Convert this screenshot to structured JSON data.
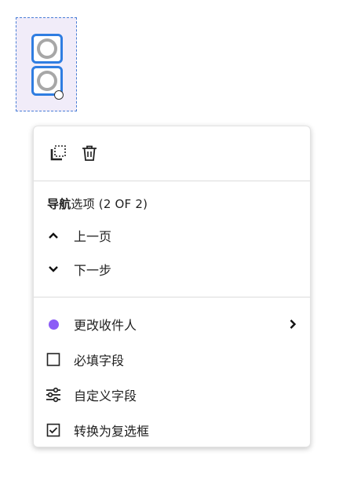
{
  "field": {
    "recipient_color": "#8b5cf6",
    "selection_color": "#2f7de1"
  },
  "menu": {
    "toolbar": {
      "duplicate_icon": "duplicate-icon",
      "delete_icon": "trash-icon"
    },
    "navigation": {
      "heading_bold": "导航",
      "heading_rest": "选项 (2 OF 2)",
      "items": [
        {
          "label": "上一页",
          "icon": "chevron-up-icon"
        },
        {
          "label": "下一步",
          "icon": "chevron-down-icon"
        }
      ]
    },
    "actions": [
      {
        "label": "更改收件人",
        "icon": "recipient-dot",
        "has_submenu": true
      },
      {
        "label": "必填字段",
        "icon": "checkbox-empty-icon"
      },
      {
        "label": "自定义字段",
        "icon": "sliders-icon"
      },
      {
        "label": "转换为复选框",
        "icon": "checkbox-checked-icon"
      }
    ]
  }
}
